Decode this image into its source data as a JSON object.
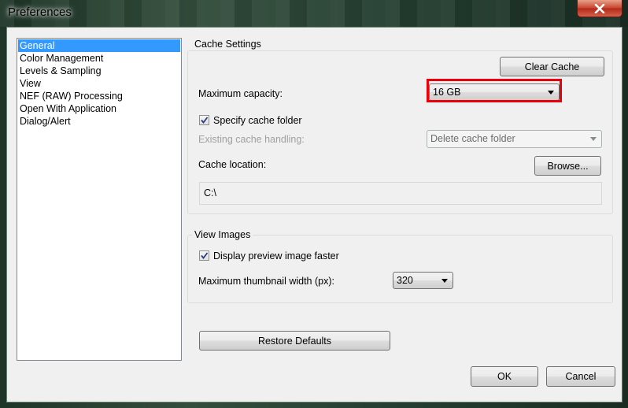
{
  "window": {
    "title": "Preferences",
    "close_label": "close"
  },
  "sidebar": {
    "items": [
      {
        "label": "General",
        "selected": true
      },
      {
        "label": "Color Management",
        "selected": false
      },
      {
        "label": "Levels & Sampling",
        "selected": false
      },
      {
        "label": "View",
        "selected": false
      },
      {
        "label": "NEF (RAW) Processing",
        "selected": false
      },
      {
        "label": "Open With Application",
        "selected": false
      },
      {
        "label": "Dialog/Alert",
        "selected": false
      }
    ]
  },
  "cache": {
    "group_label": "Cache Settings",
    "clear_cache_label": "Clear Cache",
    "max_capacity_label": "Maximum capacity:",
    "max_capacity_value": "16 GB",
    "specify_folder_label": "Specify cache folder",
    "specify_folder_checked": true,
    "existing_handling_label": "Existing cache handling:",
    "existing_handling_value": "Delete cache folder",
    "location_label": "Cache location:",
    "browse_label": "Browse...",
    "location_value": "C:\\"
  },
  "view_images": {
    "group_label": "View Images",
    "display_faster_label": "Display preview image faster",
    "display_faster_checked": true,
    "thumb_width_label": "Maximum thumbnail width (px):",
    "thumb_width_value": "320"
  },
  "footer": {
    "restore_label": "Restore Defaults",
    "ok_label": "OK",
    "cancel_label": "Cancel"
  },
  "colors": {
    "selection": "#3399ff",
    "highlight_box": "#e8000b",
    "close_button": "#c7432b"
  }
}
